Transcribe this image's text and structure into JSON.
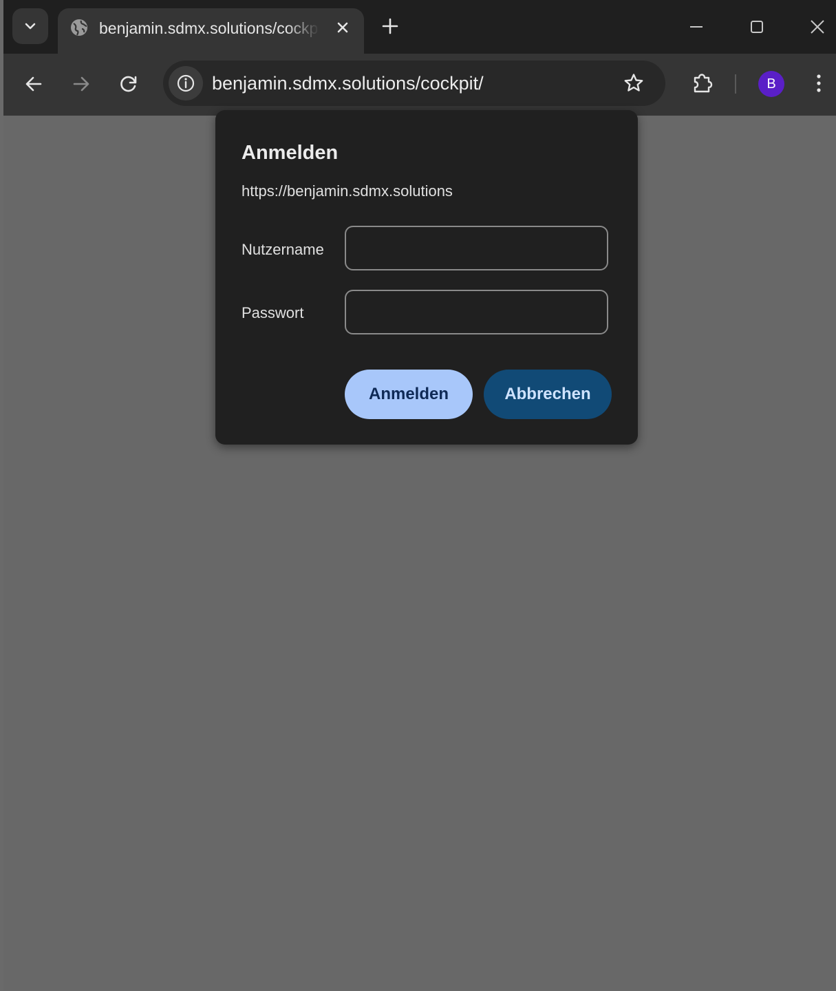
{
  "tab": {
    "title": "benjamin.sdmx.solutions/cockpit/"
  },
  "omnibox": {
    "url": "benjamin.sdmx.solutions/cockpit/"
  },
  "profile": {
    "initial": "B",
    "color": "#5a1fc7"
  },
  "dialog": {
    "title": "Anmelden",
    "origin": "https://benjamin.sdmx.solutions",
    "username_label": "Nutzername",
    "username_value": "",
    "password_label": "Passwort",
    "password_value": "",
    "submit_label": "Anmelden",
    "cancel_label": "Abbrechen"
  },
  "icons": {
    "tab_search": "chevron-down-icon",
    "favicon": "globe-icon",
    "tab_close": "close-icon",
    "new_tab": "plus-icon",
    "minimize": "minimize-icon",
    "maximize": "maximize-icon",
    "window_close": "close-icon",
    "back": "back-arrow-icon",
    "forward": "forward-arrow-icon",
    "reload": "reload-icon",
    "site_info": "info-icon",
    "bookmark": "star-icon",
    "extensions": "puzzle-icon",
    "menu": "kebab-menu-icon"
  },
  "colors": {
    "primary_button": "#a8c7fa",
    "secondary_button": "#114a76",
    "dialog_bg": "#202020",
    "page_overlay": "#686868"
  }
}
